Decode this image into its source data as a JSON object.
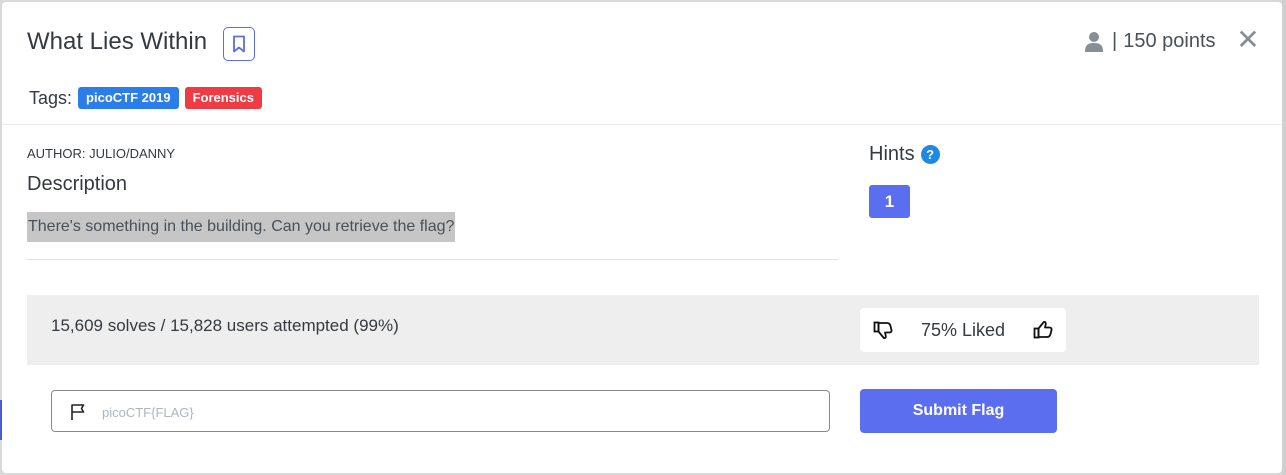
{
  "challenge": {
    "title": "What Lies Within",
    "points_separator": "|",
    "points": "150 points",
    "close_glyph": "✕"
  },
  "tags": {
    "label": "Tags:",
    "items": [
      {
        "text": "picoCTF 2019",
        "color": "#2b7de9"
      },
      {
        "text": "Forensics",
        "color": "#ef3b44"
      }
    ]
  },
  "body": {
    "author": "AUTHOR: JULIO/DANNY",
    "description_heading": "Description",
    "description_text": "There's something in the building. Can you retrieve the flag?"
  },
  "hints": {
    "heading": "Hints",
    "help_glyph": "?",
    "buttons": [
      "1"
    ]
  },
  "stats": {
    "solves": "15,609 solves / 15,828 users attempted (99%)",
    "liked": "75% Liked"
  },
  "flag_form": {
    "placeholder": "picoCTF{FLAG}",
    "value": "",
    "submit_label": "Submit Flag"
  },
  "colors": {
    "accent": "#5b6ef0",
    "tag_blue": "#2b7de9",
    "tag_red": "#ef3b44",
    "help_blue": "#1e88e5"
  },
  "icons": [
    "bookmark-icon",
    "user-icon",
    "close-icon",
    "help-icon",
    "thumbs-down-icon",
    "thumbs-up-icon",
    "flag-icon"
  ]
}
